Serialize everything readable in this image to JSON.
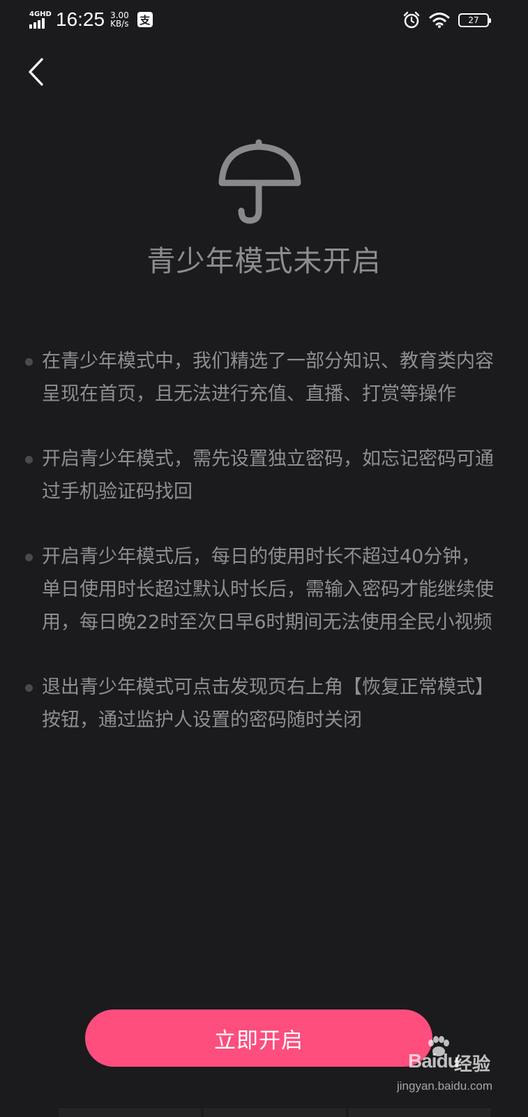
{
  "status_bar": {
    "network": "4GHD",
    "time": "16:25",
    "speed_value": "3.00",
    "speed_unit": "KB/s",
    "app_badge": "支",
    "battery": "27",
    "icons": [
      "signal-icon",
      "alipay-icon",
      "alarm-icon",
      "wifi-icon",
      "battery-icon"
    ]
  },
  "header": {
    "back_icon": "chevron-left-icon"
  },
  "hero": {
    "icon": "umbrella-icon",
    "title": "青少年模式未开启"
  },
  "info_items": [
    {
      "text": "在青少年模式中，我们精选了一部分知识、教育类内容呈现在首页，且无法进行充值、直播、打赏等操作"
    },
    {
      "text": "开启青少年模式，需先设置独立密码，如忘记密码可通过手机验证码找回"
    },
    {
      "text": "开启青少年模式后，每日的使用时长不超过40分钟，单日使用时长超过默认时长后，需输入密码才能继续使用，每日晚22时至次日早6时期间无法使用全民小视频"
    },
    {
      "text": "退出青少年模式可点击发现页右上角【恢复正常模式】按钮，通过监护人设置的密码随时关闭"
    }
  ],
  "actions": {
    "enable_label": "立即开启"
  },
  "watermark": {
    "logo": "Baidu",
    "cn": "经验",
    "url": "jingyan.baidu.com"
  },
  "colors": {
    "background": "#1b1b1d",
    "accent": "#fd4e7e",
    "text": "#8f8f91"
  }
}
